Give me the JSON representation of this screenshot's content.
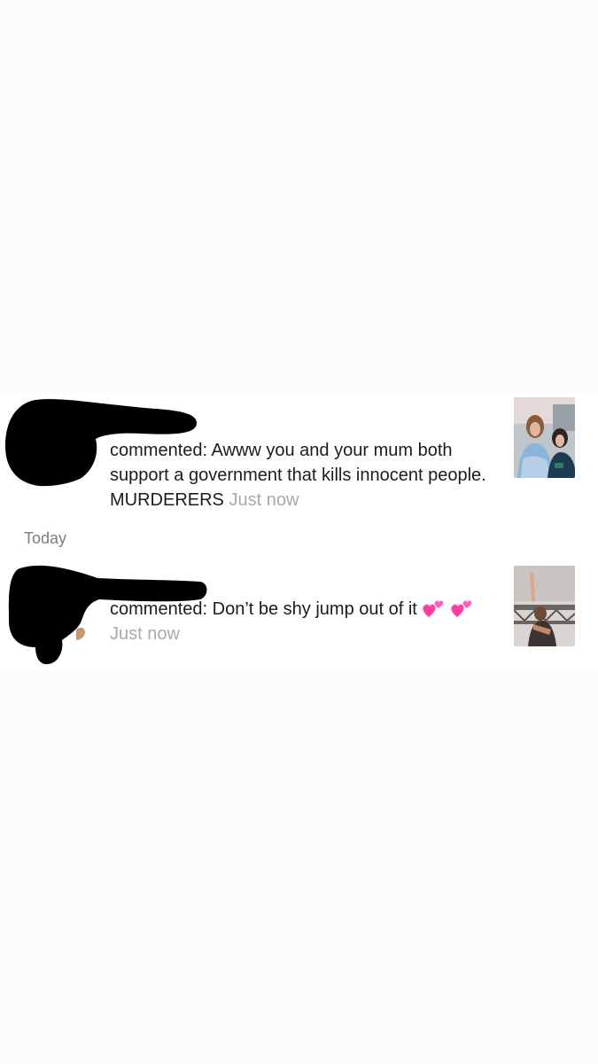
{
  "notifications": [
    {
      "action": "commented:",
      "text": "Awww you and your mum both support a government that kills innocent people. MURDERERS",
      "time": "Just now",
      "username_redacted": true,
      "thumbnail": "video-thumbnail"
    },
    {
      "action": "commented:",
      "text": "Don’t be shy jump out of it",
      "trailing_emoji": "two-hearts-emoji",
      "time": "Just now",
      "username_redacted": true,
      "thumbnail": "video-thumbnail"
    }
  ],
  "section_label": "Today",
  "colors": {
    "background": "#fdfbfb",
    "panel": "#ffffff",
    "text": "#1c1c1c",
    "timestamp": "#a9a9ad",
    "section_label": "#7d7d82",
    "heart": "#ff3fa4"
  }
}
